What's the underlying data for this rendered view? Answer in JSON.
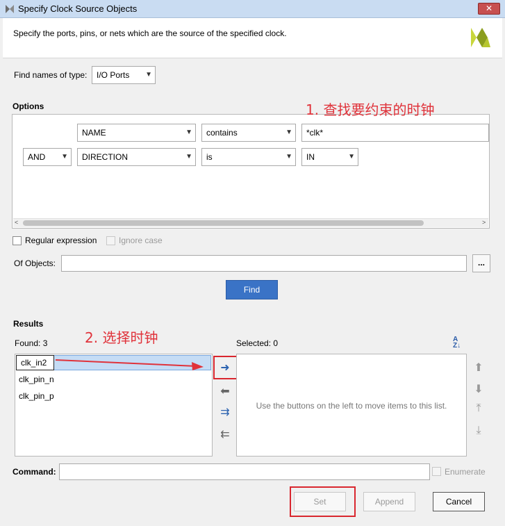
{
  "window": {
    "title": "Specify Clock Source Objects",
    "close_glyph": "✕"
  },
  "header": {
    "description": "Specify the ports, pins, or nets which are the source of the specified clock."
  },
  "find_type": {
    "label": "Find names of type:",
    "value": "I/O Ports"
  },
  "options": {
    "label": "Options",
    "row1": {
      "field": "NAME",
      "operator": "contains",
      "value": "*clk*"
    },
    "row2": {
      "conjunction": "AND",
      "field": "DIRECTION",
      "operator": "is",
      "value": "IN"
    }
  },
  "regex": {
    "label": "Regular expression",
    "checked": false
  },
  "ignore_case": {
    "label": "Ignore case",
    "checked": false,
    "disabled": true
  },
  "of_objects": {
    "label": "Of Objects:",
    "value": "",
    "browse_label": "..."
  },
  "find_button": {
    "label": "Find"
  },
  "results": {
    "label": "Results",
    "found": "Found: 3",
    "items": [
      "clk_in2",
      "clk_pin_n",
      "clk_pin_p"
    ],
    "selected_label": "Selected: 0",
    "selected_hint": "Use the buttons on the left to move items to this list."
  },
  "command": {
    "label": "Command:",
    "value": ""
  },
  "enumerate": {
    "label": "Enumerate",
    "checked": false,
    "disabled": true
  },
  "buttons": {
    "set": "Set",
    "append": "Append",
    "cancel": "Cancel"
  },
  "annotations": {
    "step1": "1. 查找要约束的时钟",
    "step2": "2. 选择时钟"
  },
  "colors": {
    "accent": "#3a73c6",
    "annotation_red": "#e0323a",
    "title_bar": "#c9dcf2"
  }
}
